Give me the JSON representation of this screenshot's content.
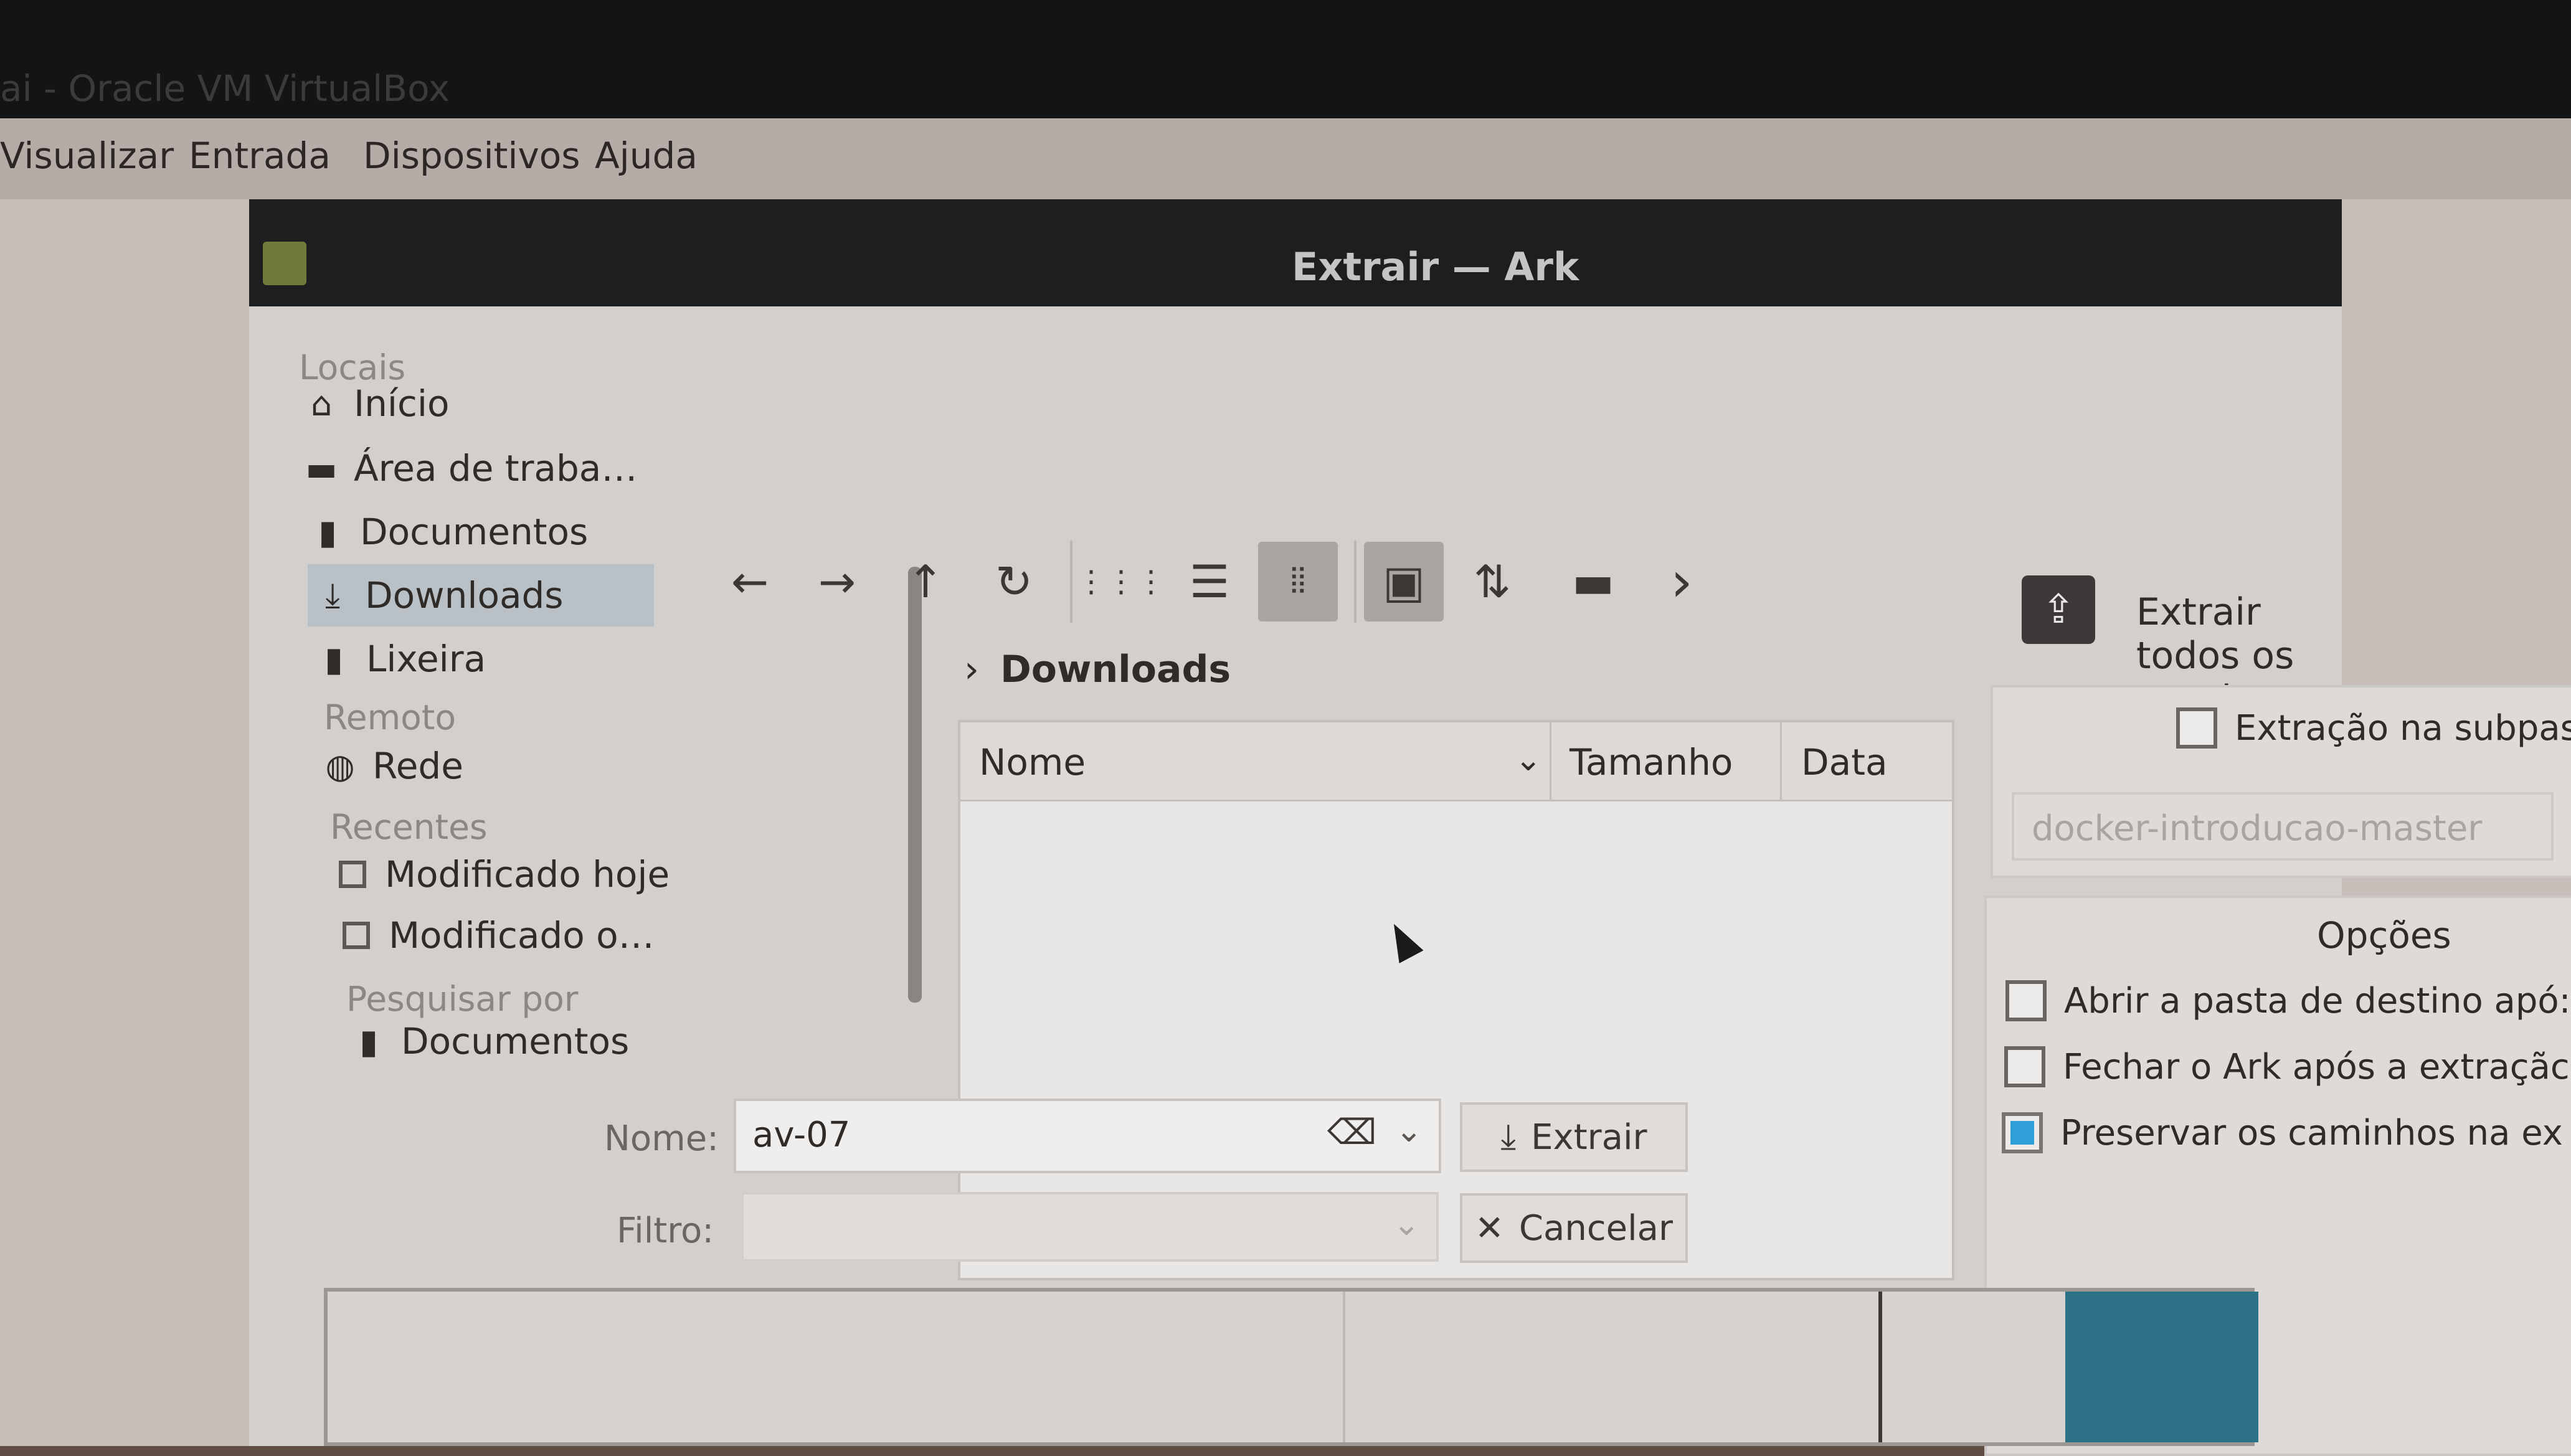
{
  "host_window": {
    "title": "ai - Oracle VM VirtualBox",
    "menu": [
      "Visualizar",
      "Entrada",
      "Dispositivos",
      "Ajuda"
    ]
  },
  "dialog": {
    "title": "Extrair — Ark"
  },
  "places": {
    "sections": {
      "locais": "Locais",
      "remoto": "Remoto",
      "recentes": "Recentes",
      "pesquisar": "Pesquisar por"
    },
    "items": [
      {
        "label": "Início",
        "icon": "home-icon"
      },
      {
        "label": "Área de traba…",
        "icon": "desktop-icon"
      },
      {
        "label": "Documentos",
        "icon": "document-icon"
      },
      {
        "label": "Downloads",
        "icon": "download-icon"
      },
      {
        "label": "Lixeira",
        "icon": "trash-icon"
      },
      {
        "label": "Rede",
        "icon": "network-icon"
      },
      {
        "label": "Modificado hoje",
        "icon": "calendar-icon"
      },
      {
        "label": "Modificado o…",
        "icon": "calendar-icon"
      },
      {
        "label": "Documentos",
        "icon": "document-icon"
      }
    ]
  },
  "toolbar": {
    "back": "←",
    "forward": "→",
    "up": "↑",
    "reload": "↻",
    "icons_view": "⋮⋮⋮",
    "list_view": "☰",
    "detail_view": "⦙⦙",
    "preview": "▣",
    "sort": "⇅",
    "new_folder": "▬",
    "more": "›"
  },
  "breadcrumb": {
    "chevron": "›",
    "current": "Downloads"
  },
  "file_list": {
    "columns": [
      "Nome",
      "Tamanho",
      "Data"
    ],
    "sort_indicator": "⌄"
  },
  "form": {
    "name_label": "Nome:",
    "name_value": "av-07",
    "filter_label": "Filtro:",
    "filter_value": "",
    "extract_button": "Extrair",
    "cancel_button": "Cancelar",
    "clear_glyph": "⌫",
    "dropdown_glyph": "⌄",
    "extract_glyph": "⤓",
    "cancel_glyph": "✕"
  },
  "right_panel": {
    "extract_all_label": "Extrair todos os arquivos",
    "subfolder_checkbox": "Extração na subpas",
    "subfolder_checked": false,
    "subfolder_value": "docker-introducao-master",
    "options_title": "Opções",
    "options": [
      {
        "label": "Abrir a pasta de destino apó:",
        "checked": false
      },
      {
        "label": "Fechar o Ark após a extraçãc",
        "checked": false
      },
      {
        "label": "Preservar os caminhos na ex",
        "checked": true
      }
    ]
  }
}
